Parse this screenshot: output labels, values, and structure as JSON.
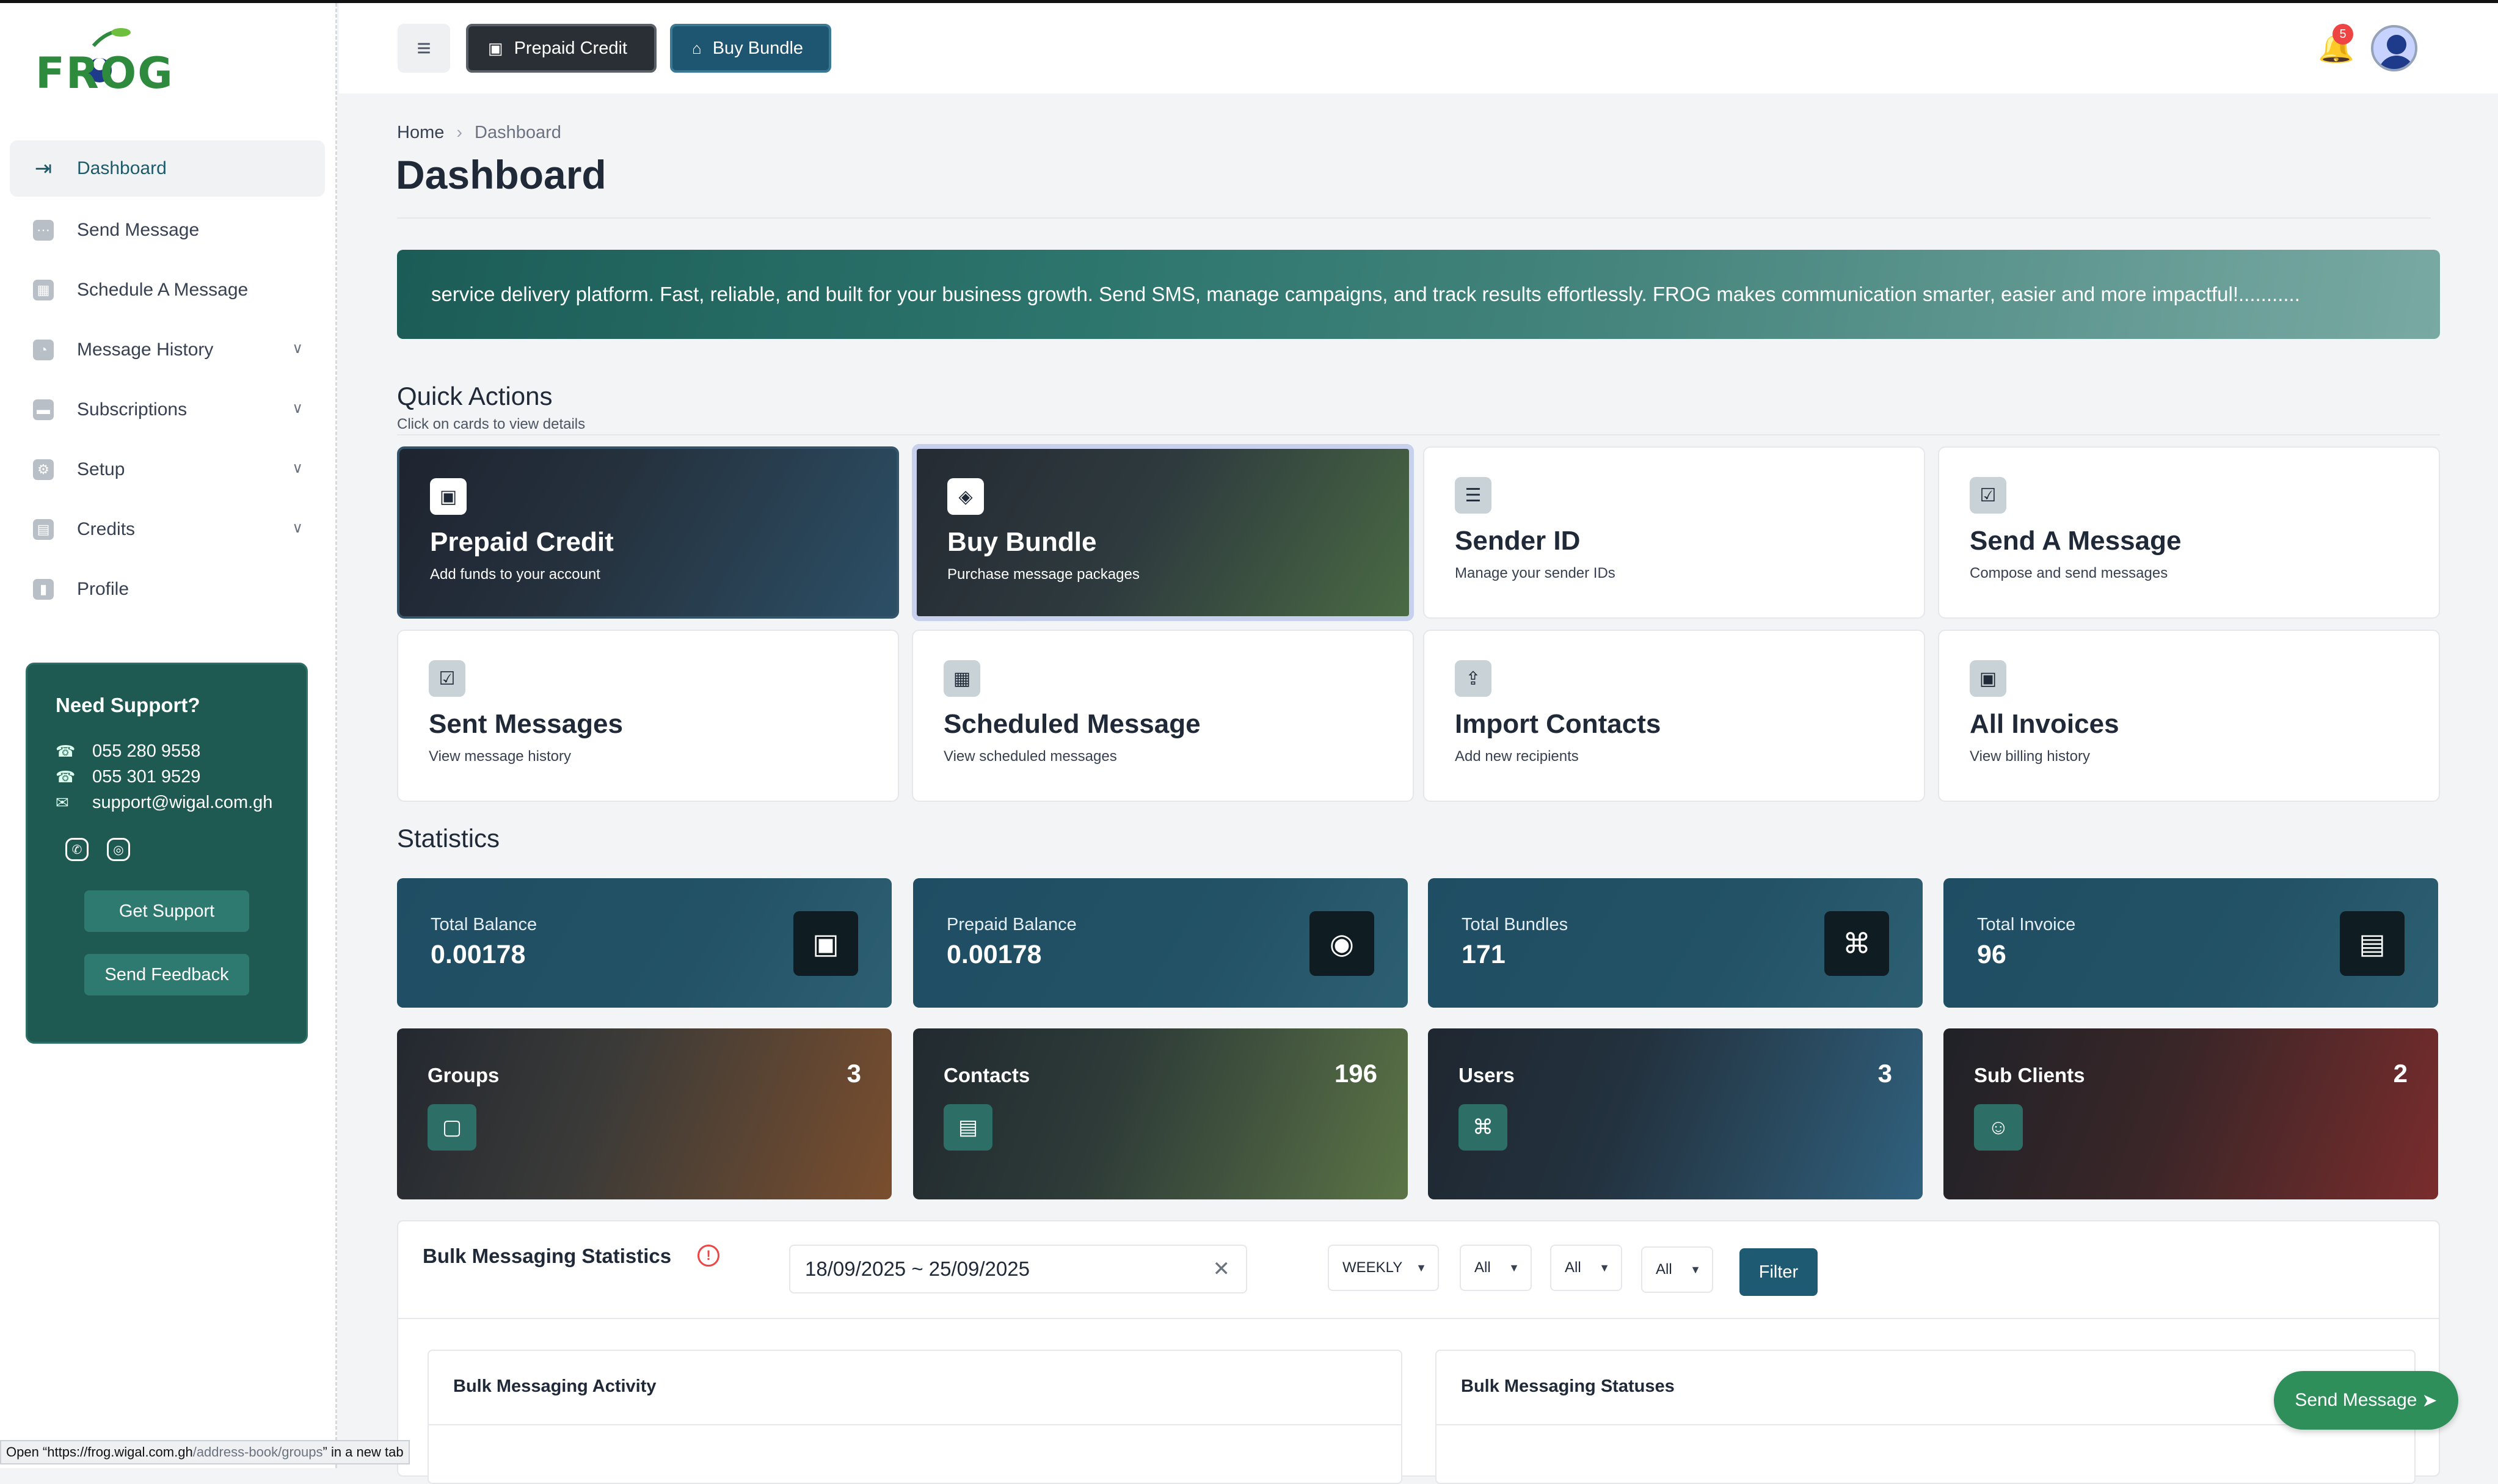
{
  "brand": {
    "logo_text": "FROG"
  },
  "sidebar": {
    "items": [
      {
        "label": "Dashboard",
        "icon": "dashboard-icon",
        "active": true
      },
      {
        "label": "Send Message",
        "icon": "chat-icon"
      },
      {
        "label": "Schedule A Message",
        "icon": "calendar-icon"
      },
      {
        "label": "Message History",
        "icon": "history-icon",
        "expandable": true
      },
      {
        "label": "Subscriptions",
        "icon": "card-icon",
        "expandable": true
      },
      {
        "label": "Setup",
        "icon": "gear-icon",
        "expandable": true
      },
      {
        "label": "Credits",
        "icon": "wallet-icon",
        "expandable": true
      },
      {
        "label": "Profile",
        "icon": "profile-icon"
      }
    ],
    "support": {
      "title": "Need Support?",
      "phone1": "055 280 9558",
      "phone2": "055 301 9529",
      "email": "support@wigal.com.gh",
      "get_support": "Get Support",
      "send_feedback": "Send Feedback"
    }
  },
  "header": {
    "prepaid_label": "Prepaid Credit",
    "bundle_label": "Buy Bundle",
    "notifications": "5"
  },
  "breadcrumb": {
    "home": "Home",
    "current": "Dashboard"
  },
  "page_title": "Dashboard",
  "banner_text": "service delivery platform. Fast, reliable, and built for your business growth. Send SMS, manage campaigns, and track results effortlessly. FROG makes communication smarter, easier and more impactful!...........",
  "quick_actions": {
    "title": "Quick Actions",
    "subtitle": "Click on cards to view details",
    "cards": [
      {
        "title": "Prepaid Credit",
        "desc": "Add funds to your account"
      },
      {
        "title": "Buy Bundle",
        "desc": "Purchase message packages"
      },
      {
        "title": "Sender ID",
        "desc": "Manage your sender IDs"
      },
      {
        "title": "Send A Message",
        "desc": "Compose and send messages"
      },
      {
        "title": "Sent Messages",
        "desc": "View message history"
      },
      {
        "title": "Scheduled Message",
        "desc": "View scheduled messages"
      },
      {
        "title": "Import Contacts",
        "desc": "Add new recipients"
      },
      {
        "title": "All Invoices",
        "desc": "View billing history"
      }
    ]
  },
  "statistics": {
    "title": "Statistics",
    "cards": [
      {
        "label": "Total Balance",
        "value": "0.00178"
      },
      {
        "label": "Prepaid Balance",
        "value": "0.00178"
      },
      {
        "label": "Total Bundles",
        "value": "171"
      },
      {
        "label": "Total Invoice",
        "value": "96"
      }
    ],
    "counts": [
      {
        "label": "Groups",
        "value": "3"
      },
      {
        "label": "Contacts",
        "value": "196"
      },
      {
        "label": "Users",
        "value": "3"
      },
      {
        "label": "Sub Clients",
        "value": "2"
      }
    ]
  },
  "bulk": {
    "title": "Bulk Messaging Statistics",
    "date_range": "18/09/2025 ~ 25/09/2025",
    "period": "WEEKLY",
    "filter1": "All",
    "filter2": "All",
    "filter3": "All",
    "filter_button": "Filter",
    "activity_title": "Bulk Messaging Activity",
    "statuses_title": "Bulk Messaging Statuses"
  },
  "fab_label": "Send Message",
  "status_bar": {
    "prefix": "Open “https://frog.wigal.com.gh",
    "path": "/address-book/groups",
    "suffix": "” in a new tab"
  }
}
